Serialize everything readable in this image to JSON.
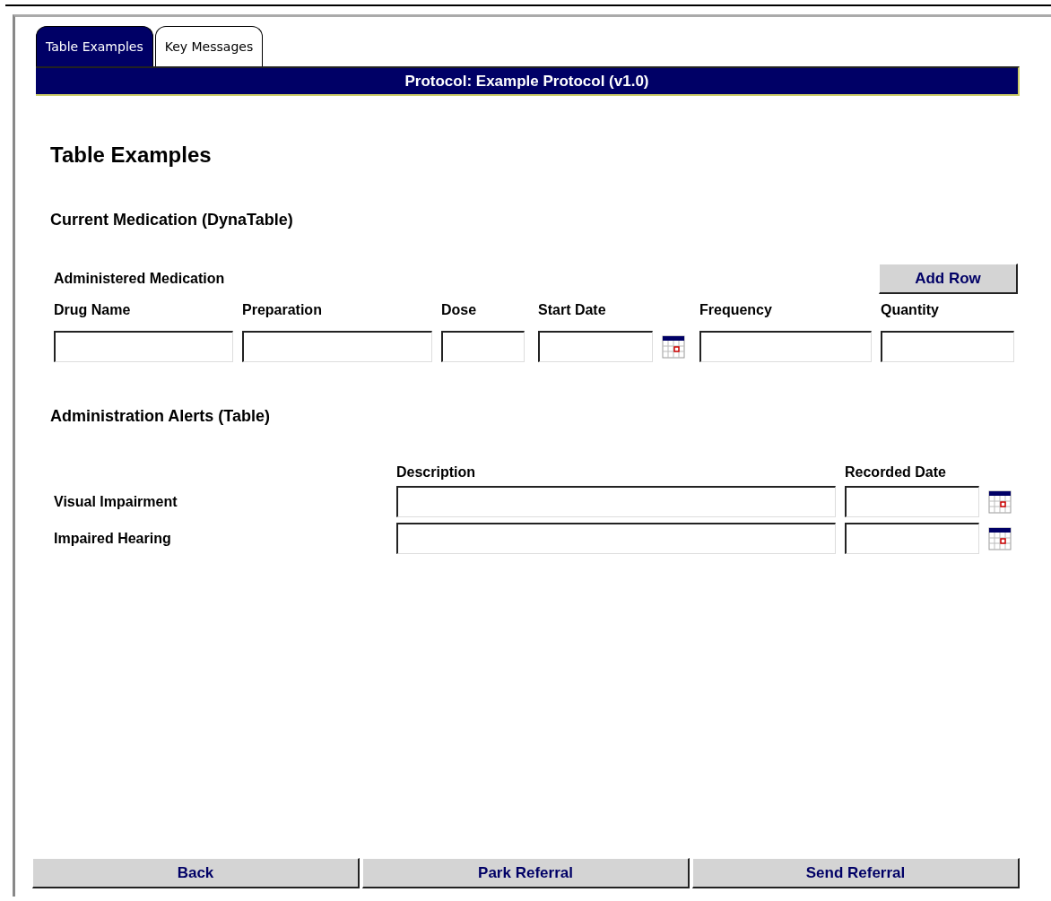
{
  "tabs": [
    {
      "label": "Table Examples",
      "selected": true
    },
    {
      "label": "Key Messages",
      "selected": false
    }
  ],
  "header": {
    "title": "Protocol: Example Protocol (v1.0)"
  },
  "page_title": "Table Examples",
  "medication": {
    "title": "Current Medication (DynaTable)",
    "table_title": "Administered Medication",
    "add_button": "Add Row",
    "columns": [
      {
        "label": "Drug Name",
        "kind": "text"
      },
      {
        "label": "Preparation",
        "kind": "text"
      },
      {
        "label": "Dose",
        "kind": "text"
      },
      {
        "label": "Start Date",
        "kind": "date"
      },
      {
        "label": "Frequency",
        "kind": "text"
      },
      {
        "label": "Quantity",
        "kind": "text"
      }
    ]
  },
  "alerts": {
    "title": "Administration Alerts (Table)",
    "columns": [
      "Description",
      "Recorded Date"
    ],
    "rows": [
      {
        "label": "Visual Impairment"
      },
      {
        "label": "Impaired Hearing"
      }
    ]
  },
  "buttons": [
    "Back",
    "Park Referral",
    "Send Referral"
  ]
}
